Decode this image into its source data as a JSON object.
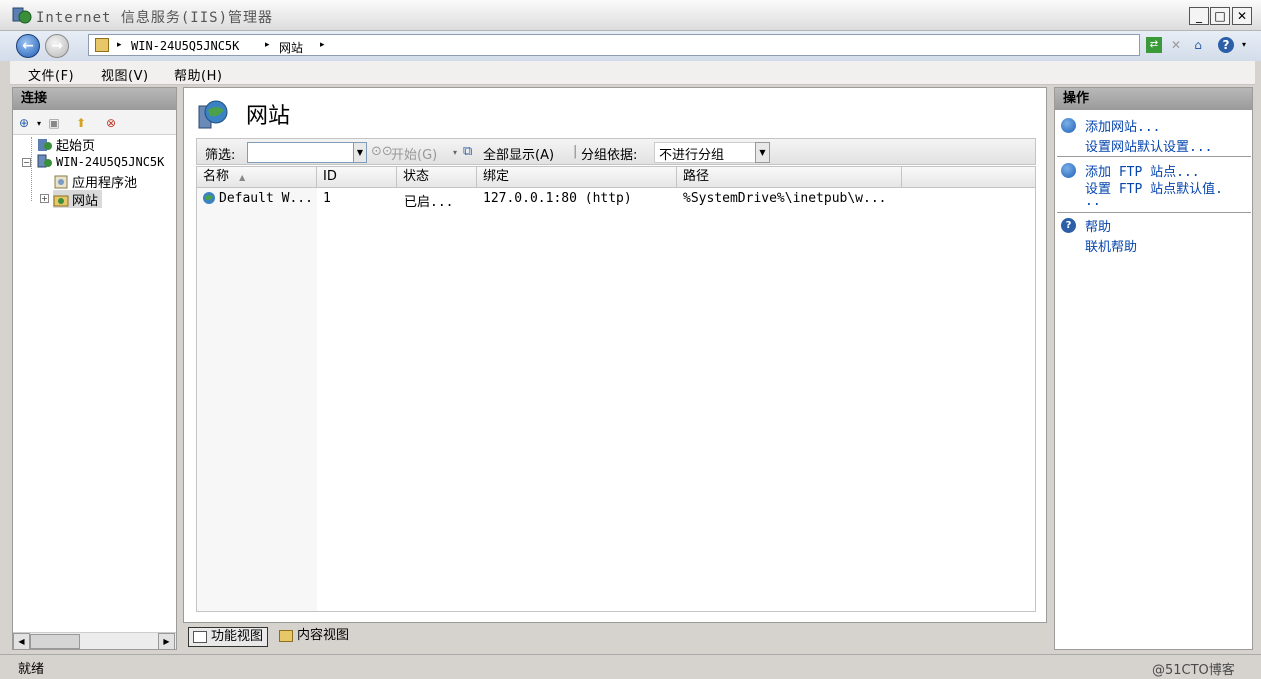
{
  "window": {
    "title": "Internet 信息服务(IIS)管理器",
    "controls": [
      "minimize-icon",
      "maximize-icon",
      "close-icon"
    ]
  },
  "address_bar": {
    "breadcrumbs": [
      "WIN-24U5Q5JNC5K",
      "网站"
    ],
    "separator": "▸"
  },
  "menu": {
    "items": [
      "文件(F)",
      "视图(V)",
      "帮助(H)"
    ]
  },
  "connections": {
    "header": "连接",
    "tree": [
      {
        "label": "起始页",
        "icon": "start-page-icon"
      },
      {
        "label": "WIN-24U5Q5JNC5K",
        "icon": "server-icon",
        "expander": "−"
      },
      {
        "label": "应用程序池",
        "icon": "app-pool-icon"
      },
      {
        "label": "网站",
        "icon": "sites-folder-icon",
        "expander": "+",
        "selected": true
      }
    ]
  },
  "center": {
    "title": "网站",
    "filter_label": "筛选:",
    "filter_value": "",
    "start_label": "开始(G)",
    "show_all_label": "全部显示(A)",
    "group_by_label": "分组依据:",
    "group_by_value": "不进行分组",
    "columns": [
      "名称",
      "ID",
      "状态",
      "绑定",
      "路径"
    ],
    "sort_indicator": "▲",
    "rows": [
      {
        "name": "Default W...",
        "id": "1",
        "status": "已启...",
        "binding": "127.0.0.1:80 (http)",
        "path": "%SystemDrive%\\inetpub\\w..."
      }
    ]
  },
  "view_tabs": {
    "features": "功能视图",
    "content": "内容视图"
  },
  "actions": {
    "header": "操作",
    "groups": [
      {
        "icon": "globe-add-icon",
        "links": [
          "添加网站...",
          "设置网站默认设置..."
        ]
      },
      {
        "icon": "globe-add-icon",
        "links": [
          "添加 FTP 站点...",
          "设置 FTP 站点默认值.",
          ".."
        ]
      },
      {
        "icon": "help-icon",
        "links": [
          "帮助",
          "联机帮助"
        ]
      }
    ]
  },
  "status": {
    "text": "就绪",
    "watermark": "@51CTO博客"
  },
  "colors": {
    "accent_link": "#0645ad",
    "pane_header": "#a9a9a9",
    "selection": "#d9d9d9"
  }
}
